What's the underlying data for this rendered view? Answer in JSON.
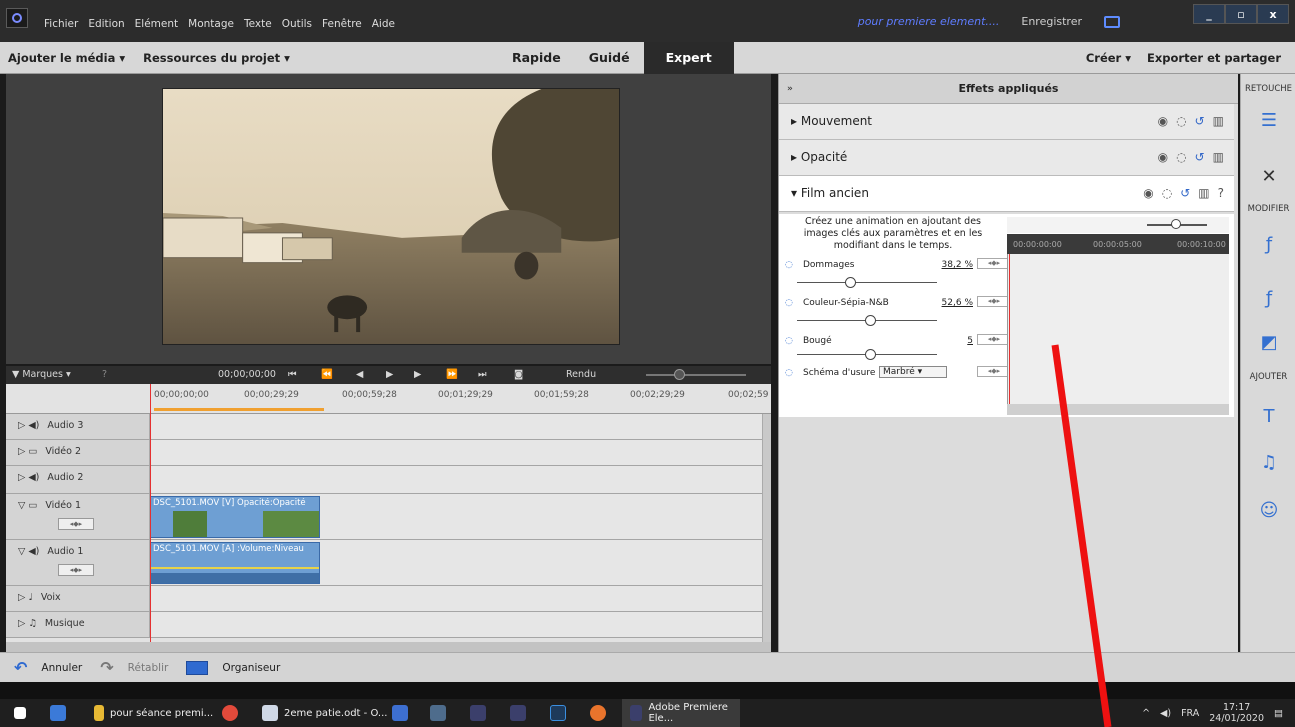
{
  "menu": [
    "Fichier",
    "Edition",
    "Elément",
    "Montage",
    "Texte",
    "Outils",
    "Fenêtre",
    "Aide"
  ],
  "title_right": {
    "project": "pour premiere element....",
    "save": "Enregistrer"
  },
  "window_buttons": [
    "_",
    "▫",
    "x"
  ],
  "modebar": {
    "add_media": "Ajouter le média ▾",
    "resources": "Ressources du projet ▾",
    "modes": [
      "Rapide",
      "Guidé",
      "Expert"
    ],
    "active_mode": "Expert",
    "create": "Créer ▾",
    "export": "Exporter et partager"
  },
  "timeline_controls": {
    "markers": "▼ Marques ▾",
    "timecode": "00;00;00;00",
    "render": "Rendu"
  },
  "ruler_times": [
    "00;00;00;00",
    "00;00;29;29",
    "00;00;59;28",
    "00;01;29;29",
    "00;01;59;28",
    "00;02;29;29",
    "00;02;59"
  ],
  "tracks": [
    {
      "name": "Audio 3"
    },
    {
      "name": "Vidéo 2"
    },
    {
      "name": "Audio 2"
    },
    {
      "name": "Vidéo 1",
      "clip": "DSC_5101.MOV [V] Opacité:Opacité"
    },
    {
      "name": "Audio 1",
      "clip": "DSC_5101.MOV [A] :Volume:Niveau"
    },
    {
      "name": "Voix"
    },
    {
      "name": "Musique"
    }
  ],
  "effects": {
    "header": "Effets appliqués",
    "items": [
      "Mouvement",
      "Opacité",
      "Film ancien"
    ],
    "description": "Créez une animation en ajoutant des images clés aux paramètres et en les modifiant dans le temps.",
    "params": [
      {
        "name": "Dommages",
        "value": "38,2 %"
      },
      {
        "name": "Couleur-Sépia-N&B",
        "value": "52,6 %"
      },
      {
        "name": "Bougé",
        "value": "5"
      }
    ],
    "wear": {
      "label": "Schéma d'usure",
      "selected": "Marbré"
    },
    "tl_times": [
      "00:00:00:00",
      "00:00:05:00",
      "00:00:10:00"
    ]
  },
  "right_tools": {
    "retouche": "RETOUCHE",
    "modifier": "MODIFIER",
    "ajouter": "AJOUTER"
  },
  "bottom": {
    "undo": "Annuler",
    "redo": "Rétablir",
    "organizer": "Organiseur"
  },
  "taskbar": {
    "item1": "pour séance premi...",
    "item2": "2eme patie.odt - O...",
    "active": "Adobe Premiere Ele...",
    "lang": "FRA",
    "time": "17:17",
    "date": "24/01/2020"
  }
}
